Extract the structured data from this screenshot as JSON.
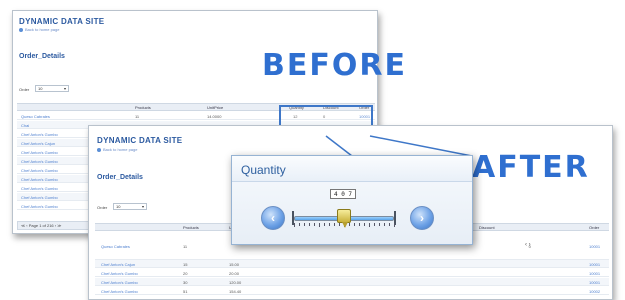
{
  "before": {
    "site_title": "DYNAMIC DATA SITE",
    "back_link": "Back to home page",
    "table_name": "Order_Details",
    "order_label": "Order",
    "order_value": "10",
    "columns": [
      "Products",
      "UnitPrice",
      "Quantity",
      "Discount",
      "Order"
    ],
    "first_row": {
      "product": "Queso Cabrales",
      "product_id": "11",
      "unit_price": "14.0000",
      "quantity": "12",
      "discount": "0",
      "order": "10001"
    },
    "rows": [
      "Chai",
      "Chef Anton's Gumbo",
      "Chef Anton's Cajun",
      "Chef Anton's Gumbo",
      "Chef Anton's Gumbo",
      "Chef Anton's Gumbo",
      "Chef Anton's Gumbo",
      "Chef Anton's Gumbo",
      "Chef Anton's Gumbo",
      "Chef Anton's Gumbo"
    ],
    "pager": "≪ ‹ Page 1 of 216 › ≫"
  },
  "after": {
    "site_title": "DYNAMIC DATA SITE",
    "back_link": "Back to home page",
    "table_name": "Order_Details",
    "order_label": "Order",
    "order_value": "10",
    "columns": [
      "Products",
      "UnitPrice",
      "Quantity",
      "Discount",
      "Order"
    ],
    "first_row": {
      "product": "Queso Cabrales",
      "product_id": "11",
      "order": "10001",
      "discount_value": "0"
    },
    "rows": [
      {
        "product": "Chef Anton's Cajun",
        "id": "15",
        "price": "15.00",
        "order": "10001"
      },
      {
        "product": "Chef Anton's Gumbo",
        "id": "20",
        "price": "20.00",
        "order": "10001"
      },
      {
        "product": "Chef Anton's Gumbo",
        "id": "30",
        "price": "120.00",
        "order": "10001"
      },
      {
        "product": "Chef Anton's Gumbo",
        "id": "51",
        "price": "154.40",
        "order": "10002"
      }
    ]
  },
  "labels": {
    "before": "BEFORE",
    "after": "AFTER"
  },
  "popup": {
    "title": "Quantity",
    "value": "4 0 7",
    "dec_symbol": "‹",
    "inc_symbol": "›",
    "slider_fraction": 0.5
  },
  "colors": {
    "accent": "#2f6fd0",
    "site_title": "#2c5aa0",
    "thumb": "#d9c84a"
  }
}
